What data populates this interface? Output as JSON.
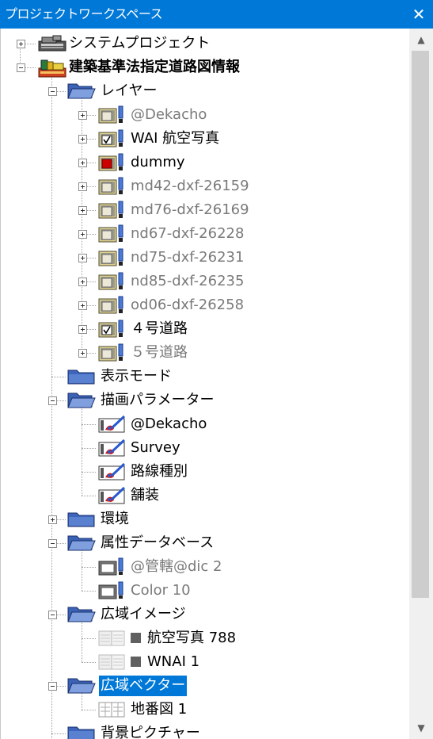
{
  "window": {
    "title": "プロジェクトワークスペース",
    "close_glyph": "✕"
  },
  "scrollbar": {
    "up_glyph": "▲",
    "down_glyph": "▼"
  },
  "nodes": [
    {
      "label": "システムプロジェクト",
      "level": 0,
      "row": 0,
      "expander": "plus",
      "icon": "system-project-icon",
      "style": "normal"
    },
    {
      "label": "建築基準法指定道路図情報",
      "level": 0,
      "row": 1,
      "expander": "minus",
      "icon": "project-books-icon",
      "style": "bold"
    },
    {
      "label": "レイヤー",
      "level": 1,
      "row": 2,
      "expander": "minus",
      "icon": "folder-open-icon",
      "style": "normal"
    },
    {
      "label": "@Dekacho",
      "level": 2,
      "row": 3,
      "expander": "plus",
      "icon": "layer-icon",
      "check": "none",
      "style": "gray"
    },
    {
      "label": "WAI 航空写真",
      "level": 2,
      "row": 4,
      "expander": "plus",
      "icon": "layer-icon",
      "check": "checked",
      "style": "normal"
    },
    {
      "label": "dummy",
      "level": 2,
      "row": 5,
      "expander": "plus",
      "icon": "layer-icon",
      "check": "red",
      "style": "normal"
    },
    {
      "label": "md42-dxf-26159",
      "level": 2,
      "row": 6,
      "expander": "plus",
      "icon": "layer-icon",
      "check": "none",
      "style": "gray"
    },
    {
      "label": "md76-dxf-26169",
      "level": 2,
      "row": 7,
      "expander": "plus",
      "icon": "layer-icon",
      "check": "none",
      "style": "gray"
    },
    {
      "label": "nd67-dxf-26228",
      "level": 2,
      "row": 8,
      "expander": "plus",
      "icon": "layer-icon",
      "check": "none",
      "style": "gray"
    },
    {
      "label": "nd75-dxf-26231",
      "level": 2,
      "row": 9,
      "expander": "plus",
      "icon": "layer-icon",
      "check": "none",
      "style": "gray"
    },
    {
      "label": "nd85-dxf-26235",
      "level": 2,
      "row": 10,
      "expander": "plus",
      "icon": "layer-icon",
      "check": "none",
      "style": "gray"
    },
    {
      "label": "od06-dxf-26258",
      "level": 2,
      "row": 11,
      "expander": "plus",
      "icon": "layer-icon",
      "check": "none",
      "style": "gray"
    },
    {
      "label": "４号道路",
      "level": 2,
      "row": 12,
      "expander": "plus",
      "icon": "layer-icon",
      "check": "checked",
      "style": "normal"
    },
    {
      "label": "５号道路",
      "level": 2,
      "row": 13,
      "expander": "plus",
      "icon": "layer-icon",
      "check": "none",
      "style": "gray"
    },
    {
      "label": "表示モード",
      "level": 1,
      "row": 14,
      "expander": "none",
      "icon": "folder-closed-icon",
      "style": "normal"
    },
    {
      "label": "描画パラメーター",
      "level": 1,
      "row": 15,
      "expander": "minus",
      "icon": "folder-open-icon",
      "style": "normal"
    },
    {
      "label": "@Dekacho",
      "level": 2,
      "row": 16,
      "expander": "none",
      "icon": "draw-param-icon",
      "style": "normal"
    },
    {
      "label": "Survey",
      "level": 2,
      "row": 17,
      "expander": "none",
      "icon": "draw-param-icon",
      "style": "normal"
    },
    {
      "label": "路線種別",
      "level": 2,
      "row": 18,
      "expander": "none",
      "icon": "draw-param-icon",
      "style": "normal"
    },
    {
      "label": "舗装",
      "level": 2,
      "row": 19,
      "expander": "none",
      "icon": "draw-param-icon",
      "style": "normal"
    },
    {
      "label": "環境",
      "level": 1,
      "row": 20,
      "expander": "plus",
      "icon": "folder-closed-icon",
      "style": "normal"
    },
    {
      "label": "属性データベース",
      "level": 1,
      "row": 21,
      "expander": "minus",
      "icon": "folder-open-icon",
      "style": "normal"
    },
    {
      "label": "@管轄@dic  2",
      "level": 2,
      "row": 22,
      "expander": "none",
      "icon": "attribute-db-icon",
      "style": "gray"
    },
    {
      "label": "Color  10",
      "level": 2,
      "row": 23,
      "expander": "none",
      "icon": "attribute-db-icon",
      "style": "gray"
    },
    {
      "label": "広域イメージ",
      "level": 1,
      "row": 24,
      "expander": "minus",
      "icon": "folder-open-icon",
      "style": "normal"
    },
    {
      "label": "航空写真  788",
      "level": 2,
      "row": 25,
      "expander": "none",
      "icon": "raster-image-icon",
      "square": true,
      "style": "normal"
    },
    {
      "label": "WNAI  1",
      "level": 2,
      "row": 26,
      "expander": "none",
      "icon": "raster-image-icon",
      "square": true,
      "style": "normal"
    },
    {
      "label": "広域ベクター",
      "level": 1,
      "row": 27,
      "expander": "minus",
      "icon": "folder-open-icon",
      "style": "selected"
    },
    {
      "label": "地番図  1",
      "level": 2,
      "row": 28,
      "expander": "none",
      "icon": "vector-map-icon",
      "style": "normal"
    },
    {
      "label": "背景ピクチャー",
      "level": 1,
      "row": 29,
      "expander": "none",
      "icon": "folder-closed-icon",
      "style": "normal"
    }
  ]
}
